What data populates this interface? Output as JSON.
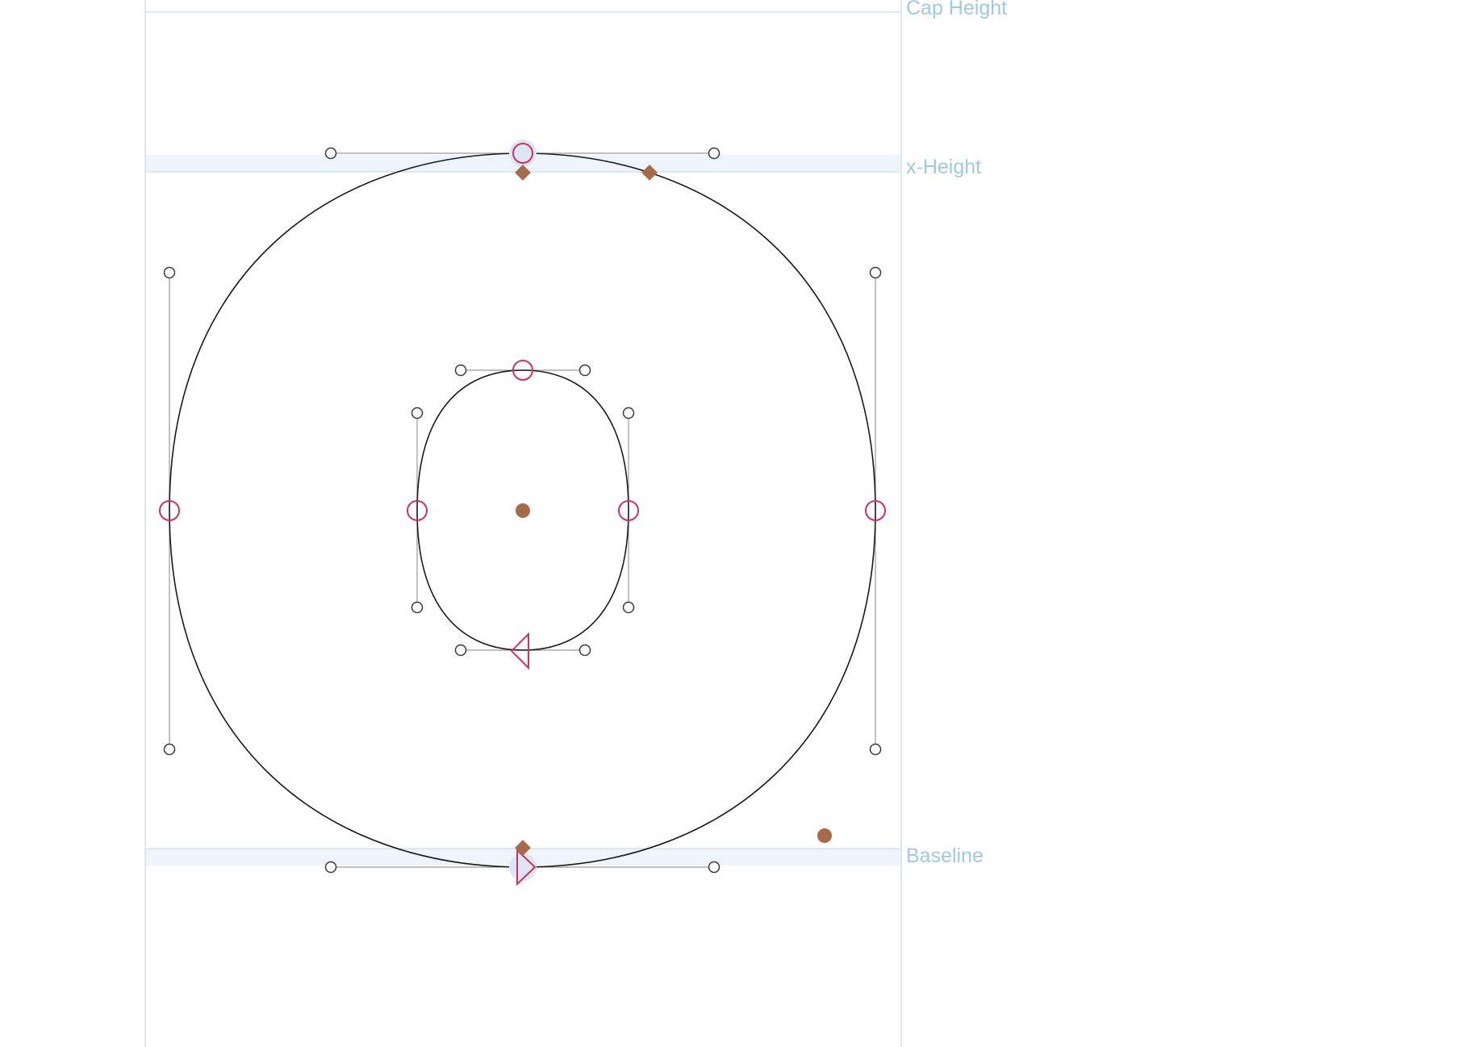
{
  "window": {
    "title": ""
  },
  "metrics": {
    "cap_height_label": "Cap Height",
    "x_height_label": "x-Height",
    "baseline_label": "Baseline"
  },
  "colors": {
    "background": "#ffffff",
    "metric_line": "#cfe3f2",
    "metric_band": "#edf5fb",
    "metric_label": "#9cc9e6",
    "outline": "#1a1a1a",
    "handle_line": "#9a9a9a",
    "handle_point": "#3a3a3a",
    "on_curve_point": "#d0305f",
    "selection_halo": "#dce6f4",
    "anchor": "#a56b4a"
  },
  "icons": {
    "on_curve_node": "circle-outline",
    "off_curve_handle": "small-circle-outline",
    "start_node": "triangle-outline",
    "anchor": "diamond-filled",
    "center_mark": "dot-filled"
  }
}
